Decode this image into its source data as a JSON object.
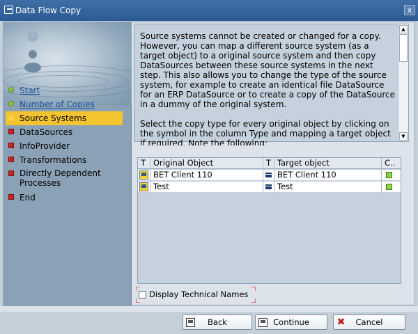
{
  "window": {
    "title": "Data Flow Copy",
    "close_label": "x"
  },
  "nav": {
    "items": [
      {
        "label": "Start",
        "status": "green",
        "link": true
      },
      {
        "label": "Number of Copies",
        "status": "green",
        "link": true
      },
      {
        "label": "Source Systems",
        "status": "yellow",
        "active": true
      },
      {
        "label": "DataSources",
        "status": "red"
      },
      {
        "label": "InfoProvider",
        "status": "red"
      },
      {
        "label": "Transformations",
        "status": "red"
      },
      {
        "label": "Directly Dependent Processes",
        "status": "red"
      },
      {
        "label": "End",
        "status": "red"
      }
    ]
  },
  "info": {
    "paragraph1": "Source systems cannot be created or changed for a copy. However, you can map a different source system (as a target object) to a original source system and then copy DataSources between these source systems in the next step. This also allows you to change the type of the source system, for example to create an identical file DataSource for an ERP DataSource or to create a copy of the DataSource in a dummy of the original system.",
    "paragraph2": "Select the copy type for every original object by clicking on the symbol in the column Type and mapping a target object if required. Note the following:"
  },
  "table": {
    "headers": {
      "type": "T",
      "original": "Original Object",
      "type2": "T",
      "target": "Target object",
      "c": "C.."
    },
    "rows": [
      {
        "original": "BET Client 110",
        "target": "BET Client 110"
      },
      {
        "original": "Test",
        "target": "Test"
      }
    ]
  },
  "options": {
    "display_technical_names": "Display Technical Names"
  },
  "buttons": {
    "back": "Back",
    "continue": "Continue",
    "cancel": "Cancel"
  },
  "colors": {
    "active_step": "#f4c430",
    "status_green": "#8ec63f",
    "status_red": "#cc2222",
    "status_yellow": "#f6d84a"
  }
}
